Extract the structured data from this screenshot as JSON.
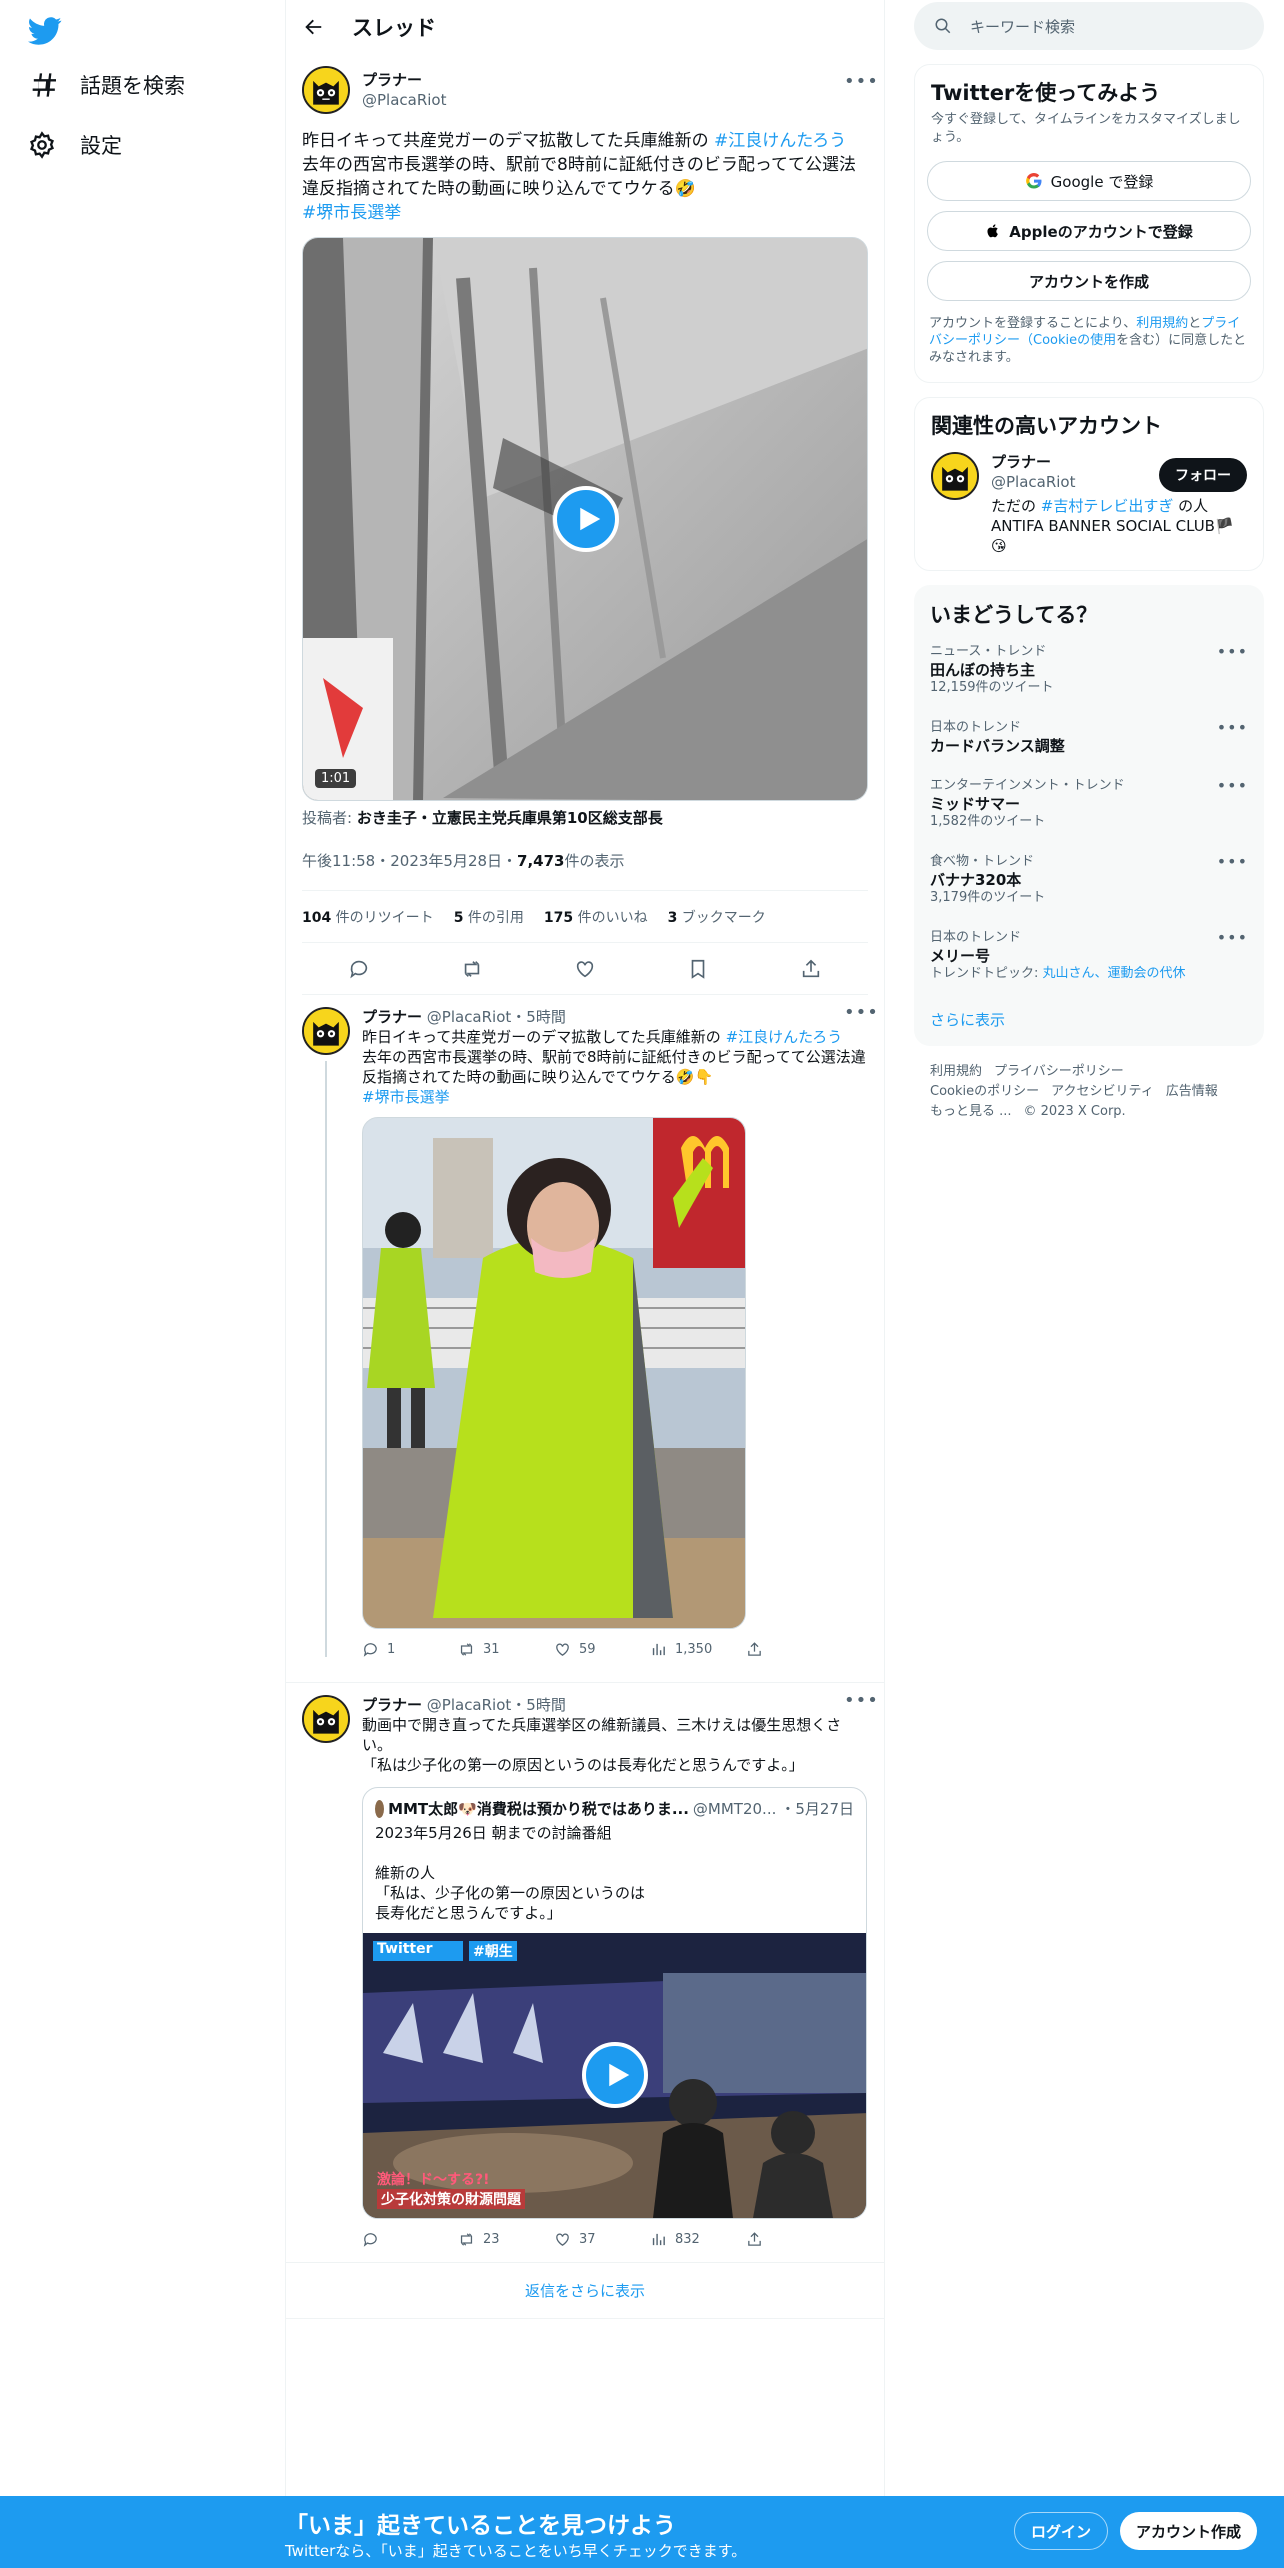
{
  "nav": {
    "explore": "話題を検索",
    "settings": "設定"
  },
  "header": {
    "title": "スレッド"
  },
  "main_tweet": {
    "display_name": "プラナー",
    "username": "@PlacaRiot",
    "text_before": "昨日イキって共産党ガーのデマ拡散してた兵庫維新の ",
    "hashtag1": "#江良けんたろう",
    "text_after": "\n去年の西宮市長選挙の時、駅前で8時前に証紙付きのビラ配ってて公選法違反指摘されてた時の動画に映り込んでてウケる🤣\n",
    "hashtag2": "#堺市長選挙",
    "duration": "1:01",
    "poster_label": "投稿者: ",
    "poster_name": "おき圭子・立憲民主党兵庫県第10区総支部長",
    "time": "午後11:58・2023年5月28日・",
    "views": "7,473",
    "views_suffix": " 件の表示",
    "retweets": "104",
    "retweets_label": " 件のリツイート",
    "quotes": "5",
    "quotes_label": " 件の引用",
    "likes": "175",
    "likes_label": " 件のいいね",
    "bookmarks": "3",
    "bookmarks_label": " ブックマーク"
  },
  "reply1": {
    "display_name": "プラナー",
    "username_time": " @PlacaRiot・5時間",
    "text_before": "昨日イキって共産党ガーのデマ拡散してた兵庫維新の ",
    "hashtag1": "#江良けんたろう",
    "text_after": "\n去年の西宮市長選挙の時、駅前で8時前に証紙付きのビラ配ってて公選法違反指摘されてた時の動画に映り込んでてウケる🤣👇\n",
    "hashtag2": "#堺市長選挙",
    "replies": "1",
    "retweets": "31",
    "likes": "59",
    "views": "1,350"
  },
  "reply2": {
    "display_name": "プラナー",
    "username_time": " @PlacaRiot・5時間",
    "text": "動画中で開き直ってた兵庫選挙区の維新議員、三木けえは優生思想くさい。\n「私は少子化の第一の原因というのは長寿化だと思うんですよ。」",
    "quote_name": "MMT太郎🐶消費税は預かり税ではありま...",
    "quote_handle": "@MMT20...",
    "quote_date": "・5月27日",
    "quote_text": "2023年5月26日 朝までの討論番組\n\n維新の人\n「私は、少子化の第一の原因というのは\n長寿化だと思うんですよ。」",
    "video_brand": "Twitter",
    "video_tag": "#朝生",
    "video_caption1": "激論！ド〜する?!",
    "video_caption2": "少子化対策の財源問題",
    "replies": "",
    "retweets": "23",
    "likes": "37",
    "views": "832"
  },
  "more_replies": "返信をさらに表示",
  "right": {
    "search_placeholder": "キーワード検索",
    "signup_title": "Twitterを使ってみよう",
    "signup_sub": "今すぐ登録して、タイムラインをカスタマイズしましょう。",
    "google_btn": "Google で登録",
    "apple_btn": "Appleのアカウントで登録",
    "create_btn": "アカウントを作成",
    "terms_a": "アカウントを登録することにより、",
    "terms_link1": "利用規約",
    "terms_b": "と",
    "terms_link2": "プライバシーポリシー（Cookieの使用",
    "terms_c": "を含む）に同意したとみなされます。",
    "related_title": "関連性の高いアカウント",
    "related_name": "プラナー",
    "related_handle": "@PlacaRiot",
    "follow": "フォロー",
    "related_bio_a": "ただの ",
    "related_bio_tag": "#吉村テレビ出すぎ",
    "related_bio_b": " の人\nANTIFA BANNER SOCIAL CLUB🏴\n😘",
    "trends_title": "いまどうしてる？",
    "trends": [
      {
        "ctx": "ニュース・トレンド",
        "name": "田んぼの持ち主",
        "count": "12,159件のツイート"
      },
      {
        "ctx": "日本のトレンド",
        "name": "カードバランス調整",
        "count": ""
      },
      {
        "ctx": "エンターテインメント・トレンド",
        "name": "ミッドサマー",
        "count": "1,582件のツイート"
      },
      {
        "ctx": "食べ物・トレンド",
        "name": "バナナ320本",
        "count": "3,179件のツイート"
      },
      {
        "ctx": "日本のトレンド",
        "name": "メリー号",
        "count": "トレンドトピック: "
      }
    ],
    "trend5_topics": "丸山さん、運動会の代休",
    "show_more": "さらに表示",
    "footer": [
      "利用規約",
      "プライバシーポリシー",
      "Cookieのポリシー",
      "アクセシビリティ",
      "広告情報",
      "もっと見る ...",
      "© 2023 X Corp."
    ]
  },
  "bottom": {
    "title": "「いま」起きていることを見つけよう",
    "sub": "Twitterなら、「いま」起きていることをいち早くチェックできます。",
    "login": "ログイン",
    "signup": "アカウント作成"
  },
  "colors": {
    "accent": "#1d9bf0",
    "text": "#0f1419",
    "muted": "#536471",
    "border": "#eff3f4"
  }
}
